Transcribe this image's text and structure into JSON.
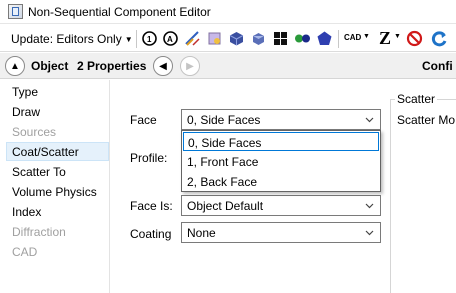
{
  "window": {
    "title": "Non-Sequential Component Editor"
  },
  "toolbar": {
    "update_label": "Update: Editors Only",
    "cad_label": "CAD",
    "z_label": "Z",
    "icons": [
      "undo-icon",
      "redo-icon",
      "ray-trace-icon",
      "analysis-icon",
      "object-cube-icon",
      "solid-cube-icon",
      "grid-view-icon",
      "dots-icon",
      "polygon-icon",
      "cad-icon",
      "z-icon",
      "no-icon",
      "refresh-icon"
    ]
  },
  "navbar": {
    "object_label": "Object",
    "properties_label": "2 Properties",
    "config_label": "Confi"
  },
  "categories": [
    {
      "label": "Type",
      "enabled": true
    },
    {
      "label": "Draw",
      "enabled": true
    },
    {
      "label": "Sources",
      "enabled": false
    },
    {
      "label": "Coat/Scatter",
      "enabled": true,
      "selected": true
    },
    {
      "label": "Scatter To",
      "enabled": true
    },
    {
      "label": "Volume Physics",
      "enabled": true
    },
    {
      "label": "Index",
      "enabled": true
    },
    {
      "label": "Diffraction",
      "enabled": false
    },
    {
      "label": "CAD",
      "enabled": false
    }
  ],
  "form": {
    "face_label": "Face",
    "face_value": "0, Side Faces",
    "profile_label": "Profile:",
    "face_is_label": "Face Is:",
    "face_is_value": "Object Default",
    "coating_label": "Coating",
    "coating_value": "None"
  },
  "face_dropdown": {
    "options": [
      "0, Side Faces",
      "1, Front Face",
      "2, Back Face"
    ],
    "selected_index": 0
  },
  "scatter": {
    "group_title": "Scatter",
    "mode_label": "Scatter Mo"
  },
  "colors": {
    "selection_bg": "#e5f1fb",
    "focus_border": "#0078d7",
    "disabled_text": "#a0a0a0"
  }
}
